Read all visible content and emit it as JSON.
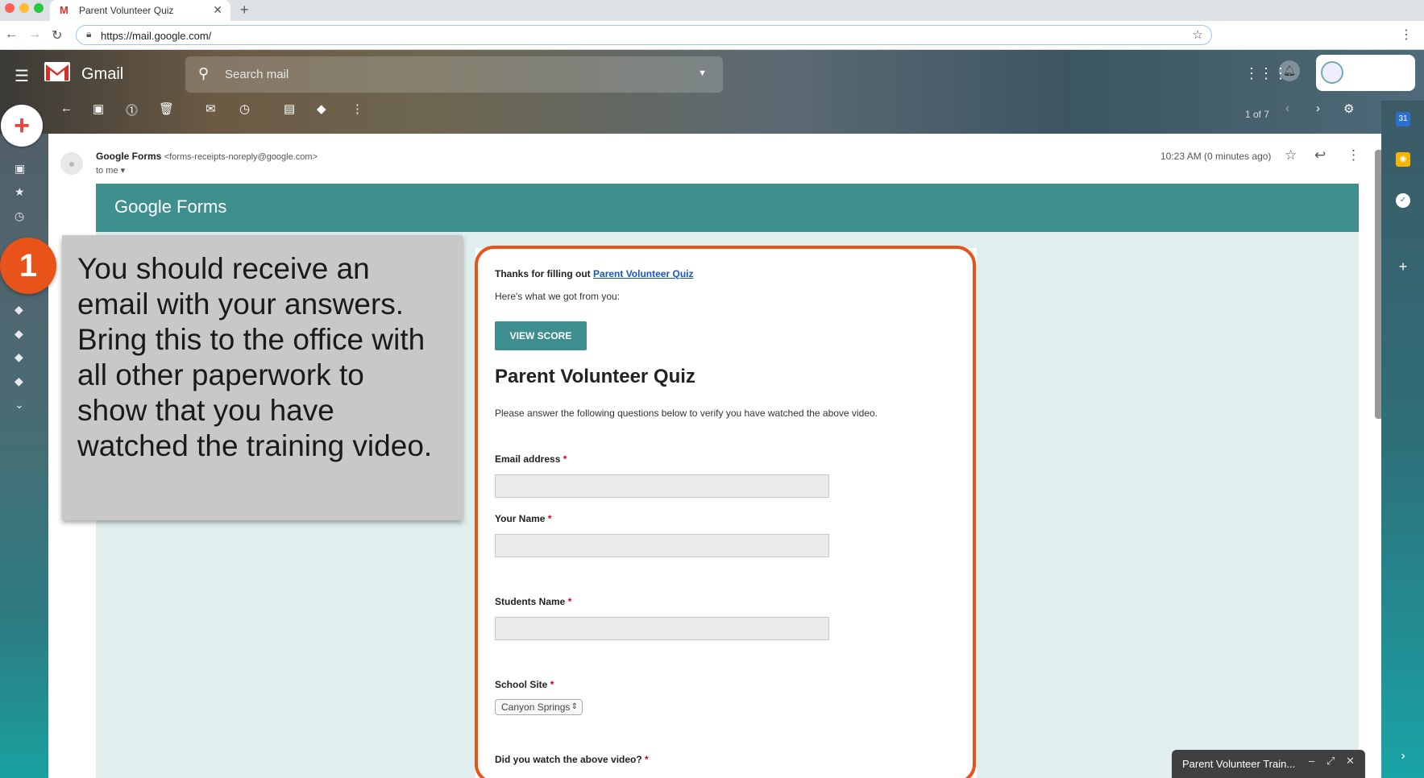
{
  "browser": {
    "tab_title": "Parent Volunteer Quiz",
    "tab_icon_letter": "M",
    "url": "https://mail.google.com/"
  },
  "gmail": {
    "app_name": "Gmail",
    "search_placeholder": "Search mail",
    "pager": "1 of 7"
  },
  "email": {
    "sender_name": "Google Forms",
    "sender_email": "<forms-receipts-noreply@google.com>",
    "recipient": "to me",
    "time": "10:23 AM (0 minutes ago)",
    "banner_logo": "Google Forms"
  },
  "form": {
    "thanks_prefix": "Thanks for filling out",
    "thanks_link": "Parent Volunteer Quiz",
    "got_from": "Here's what we got from you:",
    "view_score": "VIEW SCORE",
    "title": "Parent Volunteer Quiz",
    "description": "Please answer the following questions below to verify you have watched the above video.",
    "questions": [
      {
        "label": "Email address",
        "required": "*"
      },
      {
        "label": "Your Name",
        "required": "*"
      },
      {
        "label": "Students Name",
        "required": "*"
      },
      {
        "label": "School Site",
        "required": "*"
      },
      {
        "label": "Did you watch the above video?",
        "required": "*"
      }
    ],
    "school_site_value": "Canyon Springs"
  },
  "callout": {
    "number": "1",
    "text": "You should receive an email with your answers. Bring this to the office with all other paperwork to show that you have watched the training video."
  },
  "chat": {
    "title": "Parent Volunteer Train..."
  },
  "colors": {
    "accent_orange": "#e8531a",
    "forms_teal": "#3f8f8f"
  }
}
